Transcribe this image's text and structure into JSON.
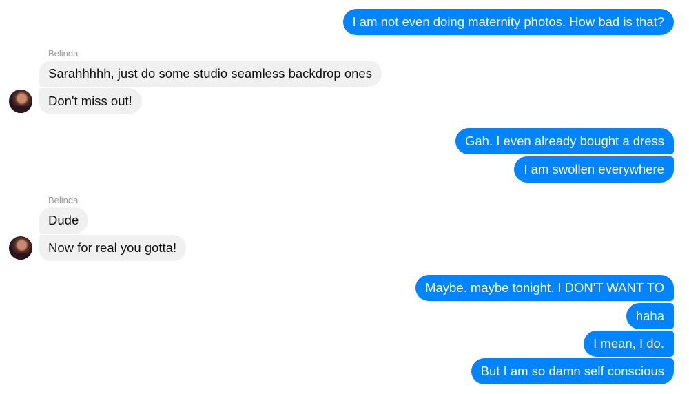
{
  "conversation": {
    "contact_name": "Belinda",
    "messages": [
      {
        "from": "me",
        "text": "I am not even doing maternity photos. How bad is that?"
      },
      {
        "from": "Belinda",
        "text": "Sarahhhhh, just do some studio seamless backdrop ones"
      },
      {
        "from": "Belinda",
        "text": "Don't miss out!"
      },
      {
        "from": "me",
        "text": "Gah. I even already bought a dress"
      },
      {
        "from": "me",
        "text": "I am swollen everywhere"
      },
      {
        "from": "Belinda",
        "text": "Dude"
      },
      {
        "from": "Belinda",
        "text": "Now for real you gotta!"
      },
      {
        "from": "me",
        "text": "Maybe. maybe tonight. I DON'T WANT TO"
      },
      {
        "from": "me",
        "text": "haha"
      },
      {
        "from": "me",
        "text": "I mean, I do."
      },
      {
        "from": "me",
        "text": "But I am so damn self conscious"
      }
    ]
  },
  "colors": {
    "outgoing_bubble": "#0084ff",
    "incoming_bubble": "#f0f0f0",
    "sender_label": "#9a9a9a"
  },
  "icons": {
    "avatar": "contact-avatar-photo"
  }
}
